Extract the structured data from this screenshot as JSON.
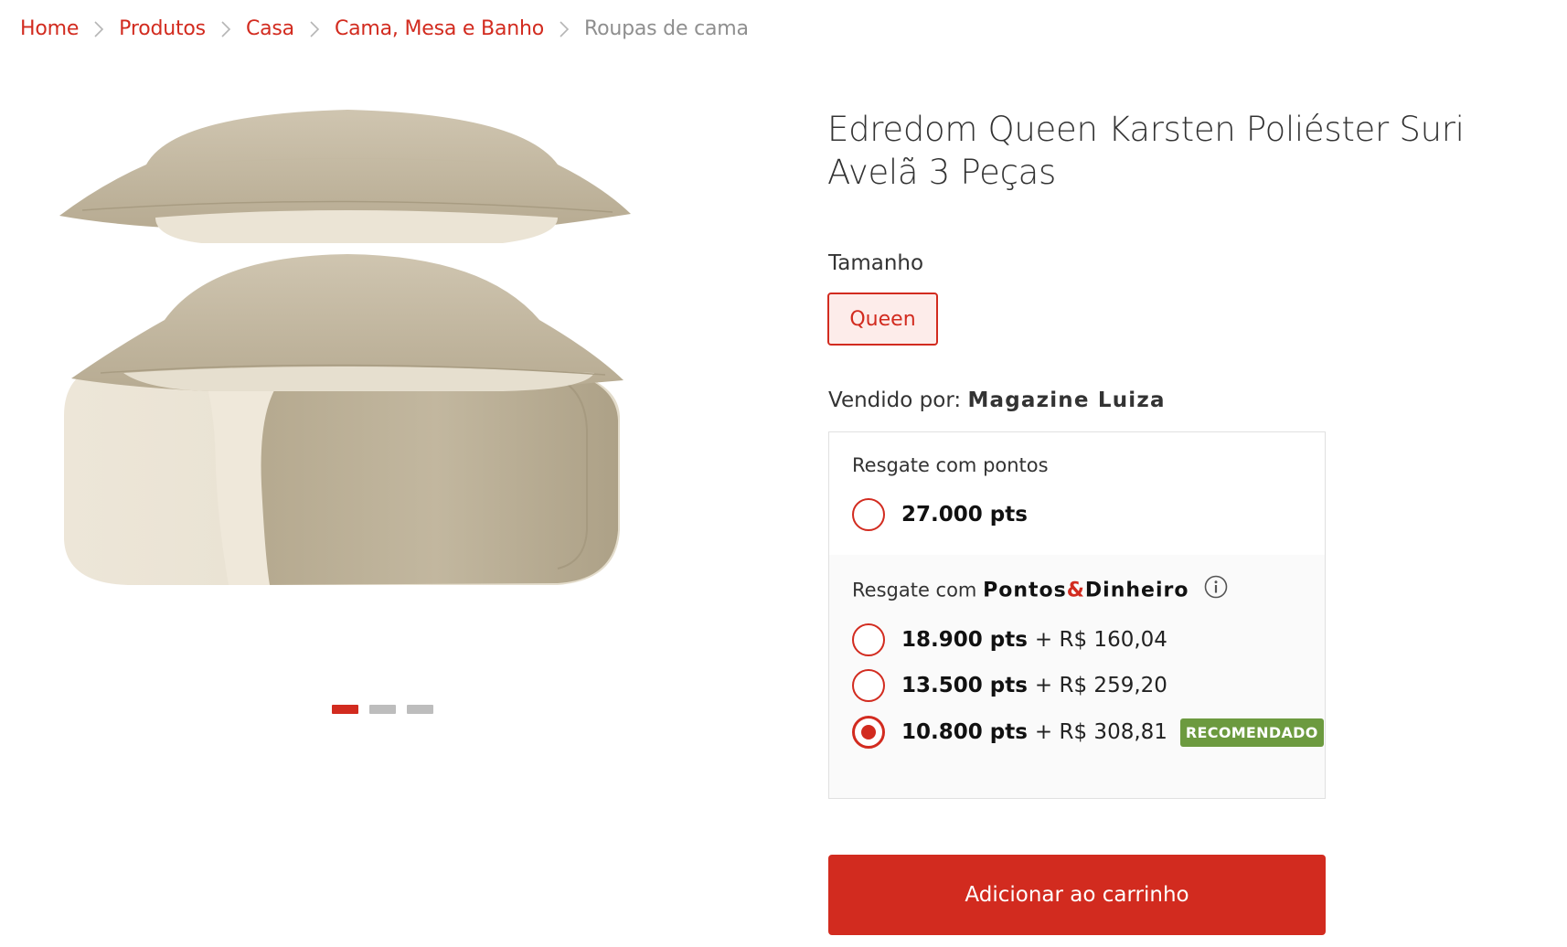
{
  "breadcrumb": {
    "items": [
      {
        "label": "Home"
      },
      {
        "label": "Produtos"
      },
      {
        "label": "Casa"
      },
      {
        "label": "Cama, Mesa e Banho"
      },
      {
        "label": "Roupas de cama"
      }
    ]
  },
  "gallery": {
    "image_count": 3,
    "active_index": 0
  },
  "product": {
    "title": "Edredom Queen Karsten Poliéster Suri Avelã 3 Peças"
  },
  "size": {
    "label": "Tamanho",
    "selected": "Queen"
  },
  "seller": {
    "prefix": "Vendido por:",
    "name": "Magazine Luiza"
  },
  "redeem": {
    "points_heading": "Resgate com pontos",
    "points_option": {
      "points": "27.000 pts",
      "selected": false
    },
    "mixed_heading_prefix": "Resgate com",
    "mixed_brand_part1": "Pontos",
    "mixed_brand_amp": "&",
    "mixed_brand_part2": "Dinheiro",
    "mixed_options": [
      {
        "points": "18.900 pts",
        "money": "+ R$ 160,04",
        "selected": false,
        "badge": ""
      },
      {
        "points": "13.500 pts",
        "money": "+ R$ 259,20",
        "selected": false,
        "badge": ""
      },
      {
        "points": "10.800 pts",
        "money": "+ R$ 308,81",
        "selected": true,
        "badge": "RECOMENDADO"
      }
    ]
  },
  "cta": {
    "add_to_cart": "Adicionar ao carrinho"
  },
  "colors": {
    "accent": "#d22b1f",
    "badge": "#6c9a3f",
    "crumb_current": "#8f8f8f"
  },
  "icons": [
    "chevron-right-icon",
    "info-icon"
  ]
}
